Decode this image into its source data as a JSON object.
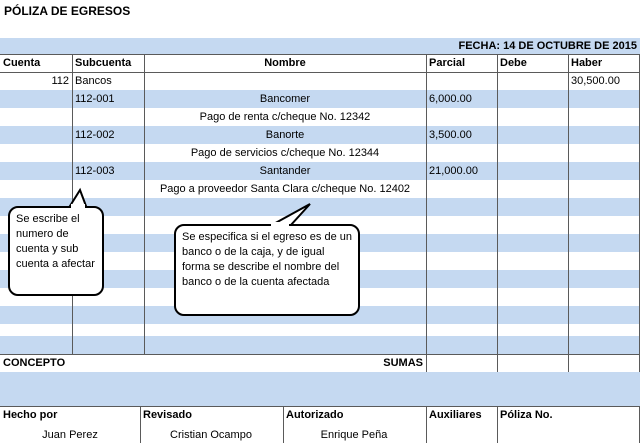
{
  "title": "PÓLIZA DE EGRESOS",
  "fecha": "FECHA: 14 DE OCTUBRE DE 2015",
  "headers": {
    "cuenta": "Cuenta",
    "subcuenta": "Subcuenta",
    "nombre": "Nombre",
    "parcial": "Parcial",
    "debe": "Debe",
    "haber": "Haber"
  },
  "rows": [
    {
      "cuenta": "112",
      "subcuenta": "Bancos",
      "nombre": "",
      "parcial": "",
      "debe": "",
      "haber": "30,500.00"
    },
    {
      "cuenta": "",
      "subcuenta": "112-001",
      "nombre": "Bancomer",
      "parcial": "6,000.00",
      "debe": "",
      "haber": ""
    },
    {
      "cuenta": "",
      "subcuenta": "",
      "nombre": "Pago de renta c/cheque No. 12342",
      "parcial": "",
      "debe": "",
      "haber": ""
    },
    {
      "cuenta": "",
      "subcuenta": "112-002",
      "nombre": "Banorte",
      "parcial": "3,500.00",
      "debe": "",
      "haber": ""
    },
    {
      "cuenta": "",
      "subcuenta": "",
      "nombre": "Pago de servicios c/cheque No. 12344",
      "parcial": "",
      "debe": "",
      "haber": ""
    },
    {
      "cuenta": "",
      "subcuenta": "112-003",
      "nombre": "Santander",
      "parcial": "21,000.00",
      "debe": "",
      "haber": ""
    },
    {
      "cuenta": "",
      "subcuenta": "",
      "nombre": "Pago a proveedor Santa Clara c/cheque No. 12402",
      "parcial": "",
      "debe": "",
      "haber": ""
    }
  ],
  "concepto_label": "CONCEPTO",
  "sumas_label": "SUMAS",
  "callouts": {
    "left": "Se escribe el numero de cuenta y sub cuenta a afectar",
    "center": "Se especifica si el egreso es de un banco o de la caja, y de igual forma se describe el nombre del banco o de la cuenta afectada"
  },
  "footer": {
    "hecho_por_label": "Hecho por",
    "revisado_label": "Revisado",
    "autorizado_label": "Autorizado",
    "auxiliares_label": "Auxiliares",
    "poliza_label": "Póliza No.",
    "hecho_por": "Juan Perez",
    "revisado": "Cristian Ocampo",
    "autorizado": "Enrique Peña"
  },
  "colors": {
    "band": "#c5d9f1",
    "border": "#5a5a5a"
  }
}
